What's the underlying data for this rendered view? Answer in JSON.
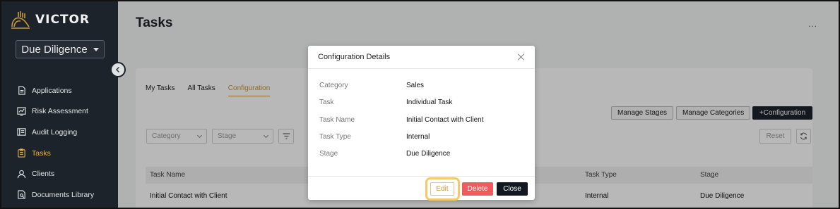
{
  "brand": {
    "name": "VICTOR"
  },
  "sidebar": {
    "stage_selector": "Due Diligence",
    "items": [
      {
        "label": "Applications",
        "icon": "document-icon",
        "active": false
      },
      {
        "label": "Risk Assessment",
        "icon": "chart-line-icon",
        "active": false
      },
      {
        "label": "Audit Logging",
        "icon": "audit-log-icon",
        "active": false
      },
      {
        "label": "Tasks",
        "icon": "clipboard-icon",
        "active": true
      },
      {
        "label": "Clients",
        "icon": "user-icon",
        "active": false
      },
      {
        "label": "Documents Library",
        "icon": "document-search-icon",
        "active": false
      }
    ]
  },
  "header": {
    "title": "Tasks",
    "more": "..."
  },
  "tabs": [
    {
      "label": "My Tasks",
      "active": false
    },
    {
      "label": "All Tasks",
      "active": false
    },
    {
      "label": "Configuration",
      "active": true
    }
  ],
  "toolbar": {
    "manage_stages": "Manage Stages",
    "manage_categories": "Manage Categories",
    "add_configuration": "+Configuration"
  },
  "filters": {
    "category_placeholder": "Category",
    "stage_placeholder": "Stage",
    "reset": "Reset"
  },
  "table": {
    "columns": [
      "Task Name",
      "Task Type",
      "Stage"
    ],
    "rows": [
      {
        "task_name": "Initial Contact with Client",
        "task_type": "Internal",
        "stage": "Due Diligence"
      }
    ]
  },
  "modal": {
    "title": "Configuration Details",
    "fields": [
      {
        "label": "Category",
        "value": "Sales"
      },
      {
        "label": "Task",
        "value": "Individual Task"
      },
      {
        "label": "Task Name",
        "value": "Initial Contact with Client"
      },
      {
        "label": "Task Type",
        "value": "Internal"
      },
      {
        "label": "Stage",
        "value": "Due Diligence"
      }
    ],
    "buttons": {
      "edit": "Edit",
      "delete": "Delete",
      "close": "Close"
    }
  },
  "colors": {
    "sidebar_bg": "#1c232b",
    "accent_gold": "#c9962c",
    "delete_red": "#ef5a5f",
    "dark_button": "#121820"
  }
}
